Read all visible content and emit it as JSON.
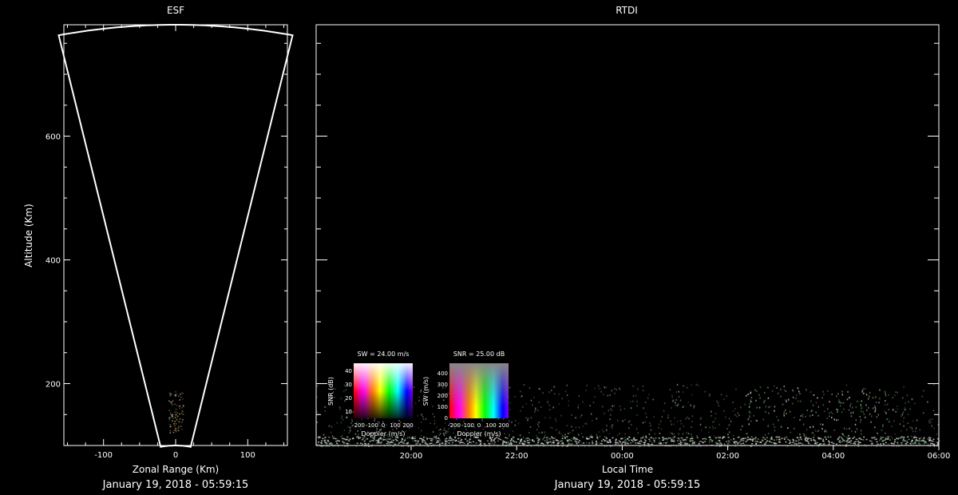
{
  "colors": {
    "background": "#000000",
    "foreground": "#ffffff"
  },
  "esf": {
    "title": "ESF",
    "xlabel": "Zonal Range (Km)",
    "ylabel": "Altitude (Km)",
    "timestamp": "January 19, 2018 - 05:59:15"
  },
  "rtdi": {
    "title": "RTDI",
    "xlabel": "Local Time",
    "timestamp": "January 19, 2018 - 05:59:15"
  },
  "legend_sw": {
    "title": "SW = 24.00 m/s",
    "ylabel": "SNR (dB)",
    "xlabel": "Doppler (m/s)",
    "yticks": [
      "40",
      "30",
      "20",
      "10"
    ],
    "xticks": [
      "-200",
      "-100",
      "0",
      "100",
      "200"
    ]
  },
  "legend_snr": {
    "title": "SNR = 25.00 dB",
    "ylabel": "SW (m/s)",
    "xlabel": "Doppler (m/s)",
    "yticks": [
      "400",
      "300",
      "200",
      "100",
      "0"
    ],
    "xticks": [
      "-200",
      "-100",
      "0",
      "100",
      "200"
    ]
  },
  "chart_data": [
    {
      "type": "scatter",
      "title": "ESF",
      "xlabel": "Zonal Range (Km)",
      "ylabel": "Altitude (Km)",
      "xlim": [
        -155,
        155
      ],
      "ylim": [
        100,
        780
      ],
      "xticks": [
        -100,
        0,
        100
      ],
      "yticks": [
        200,
        400,
        600
      ],
      "beam_sector": {
        "half_angle_deg": 12,
        "range_min_km": 100,
        "range_max_km": 780
      },
      "echo_region": {
        "x": [
          -10,
          10
        ],
        "altitude": [
          120,
          190
        ]
      }
    },
    {
      "type": "heatmap",
      "title": "RTDI",
      "xlabel": "Local Time",
      "xticks": [
        "20:00",
        "22:00",
        "00:00",
        "02:00",
        "04:00",
        "06:00"
      ],
      "xlim_hours": [
        18.2,
        30.0
      ],
      "ylim": [
        100,
        780
      ],
      "echo_band": {
        "altitude": [
          100,
          200
        ]
      },
      "strong_block": {
        "time": [
          "02:20",
          "05:05"
        ],
        "altitude": [
          110,
          195
        ]
      }
    }
  ]
}
